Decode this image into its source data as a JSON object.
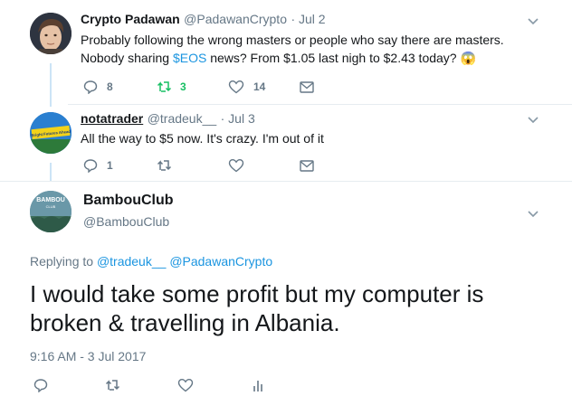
{
  "tweets": [
    {
      "author": "Crypto Padawan",
      "handle": "@PadawanCrypto",
      "date": "· Jul 2",
      "text_line1": "Probably following the wrong masters or people who say there are masters.",
      "text_line2_a": "Nobody sharing ",
      "text_line2_link": "$EOS",
      "text_line2_b": " news? From $1.05 last nigh to $2.43 today?",
      "emoji": "😱",
      "replies": "8",
      "retweets": "3",
      "likes": "14"
    },
    {
      "author": "notatrader",
      "handle": "@tradeuk__",
      "date": "· Jul 3",
      "text": "All the way to $5 now. It's crazy. I'm out of it",
      "replies": "1",
      "avatar_text": "Bright Futures Ahead"
    }
  ],
  "main_tweet": {
    "author": "BambouClub",
    "handle": "@BambouClub",
    "avatar_text_top": "BAMBOU",
    "avatar_text_bottom": "CLUB",
    "replying_label": "Replying to",
    "reply_to_1": "@tradeuk__",
    "reply_to_2": "@PadawanCrypto",
    "text_line1": "I would take some profit but my computer is",
    "text_line2": "broken & travelling in Albania.",
    "timestamp": "9:16 AM - 3 Jul 2017"
  },
  "colors": {
    "accent": "#1b95e0",
    "retweet_green": "#17bf63",
    "muted": "#657786",
    "thread_line": "#cce4f6"
  },
  "icons": [
    "reply-icon",
    "retweet-icon",
    "heart-icon",
    "envelope-icon",
    "chevron-down-icon",
    "analytics-icon"
  ]
}
